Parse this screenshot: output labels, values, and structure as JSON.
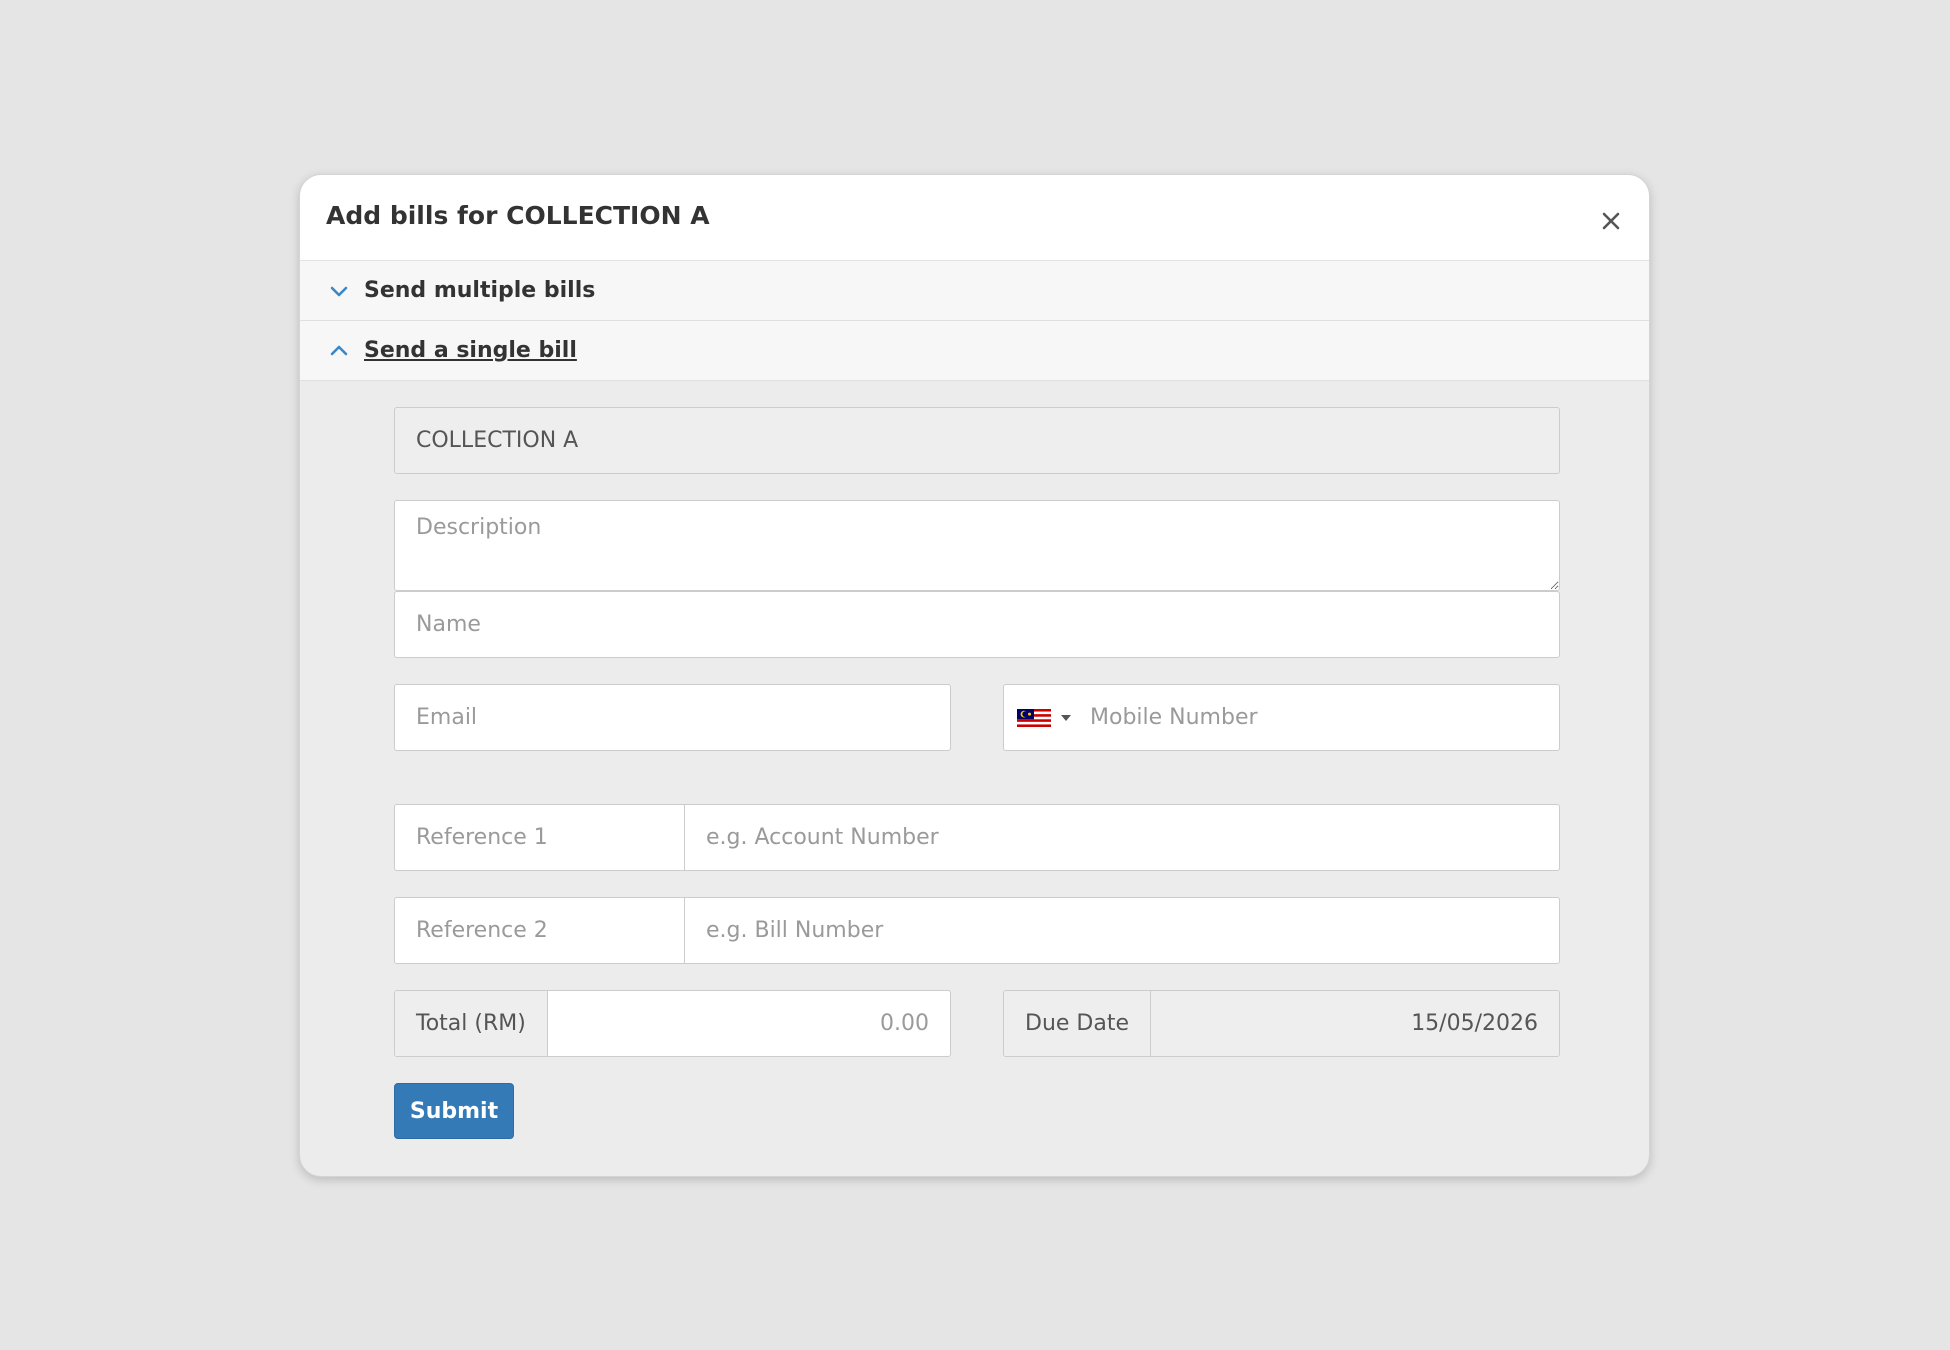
{
  "modal": {
    "title": "Add bills for COLLECTION A",
    "close_icon": "close-icon"
  },
  "accordion": {
    "multiple": {
      "label": "Send multiple bills",
      "icon": "chevron-down-icon"
    },
    "single": {
      "label": "Send a single bill",
      "icon": "chevron-up-icon"
    }
  },
  "form": {
    "collection_value": "COLLECTION A",
    "description_placeholder": "Description",
    "name_placeholder": "Name",
    "email_placeholder": "Email",
    "mobile_placeholder": "Mobile Number",
    "country_flag": "malaysia-flag-icon",
    "reference1_label_placeholder": "Reference 1",
    "reference1_value_placeholder": "e.g. Account Number",
    "reference2_label_placeholder": "Reference 2",
    "reference2_value_placeholder": "e.g. Bill Number",
    "total_label": "Total (RM)",
    "total_placeholder": "0.00",
    "due_date_label": "Due Date",
    "due_date_value": "15/05/2026",
    "submit_label": "Submit"
  },
  "colors": {
    "primary": "#337ab7",
    "accent_chevron": "#3a87c8",
    "background": "#e5e5e5"
  }
}
